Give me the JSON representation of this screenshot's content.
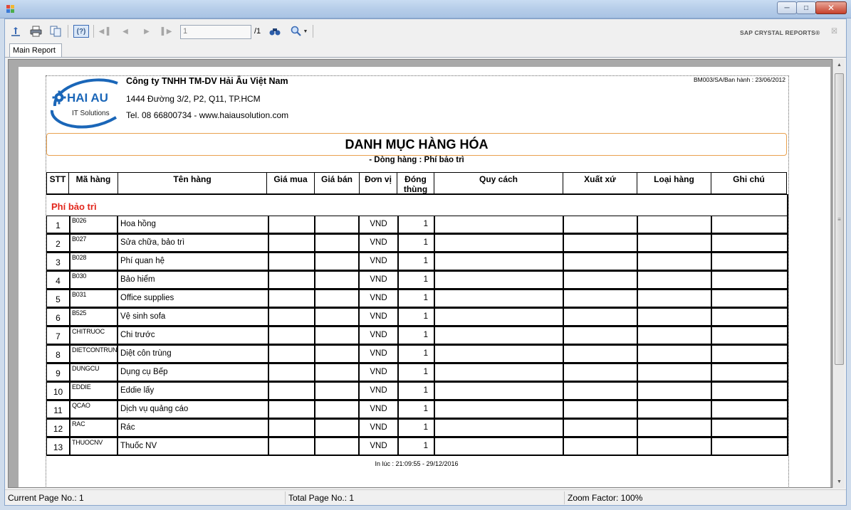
{
  "toolbar": {
    "page_value": "1",
    "page_total": "/1",
    "brand": "SAP CRYSTAL REPORTS®",
    "help_label": "(?)"
  },
  "tabs": [
    {
      "label": "Main Report"
    }
  ],
  "report": {
    "logo_text": "HAI AU",
    "logo_sub": "IT Solutions",
    "company_name": "Công ty TNHH TM-DV Hải Âu Việt Nam",
    "company_address": "1444 Đường 3/2, P2, Q11, TP.HCM",
    "company_contact": "Tel. 08 66800734 - www.haiausolution.com",
    "doc_code": "BM003/SA/Ban hành : 23/06/2012",
    "title": "DANH MỤC HÀNG HÓA",
    "subtitle": "- Dòng hàng : Phí bảo trì",
    "group_label": "Phí bảo trì",
    "print_time": "In lúc : 21:09:55 - 29/12/2016",
    "columns": {
      "stt": "STT",
      "code": "Mã hàng",
      "name": "Tên hàng",
      "buy": "Giá mua",
      "sell": "Giá bán",
      "unit": "Đơn vị",
      "pack1": "Đóng",
      "pack2": "thùng",
      "spec": "Quy cách",
      "origin": "Xuất xứ",
      "type": "Loại hàng",
      "note": "Ghi chú"
    },
    "rows": [
      {
        "stt": "1",
        "code": "B026",
        "name": "Hoa hồng",
        "unit": "VND",
        "qty": "1"
      },
      {
        "stt": "2",
        "code": "B027",
        "name": "Sửa chữa, bảo trì",
        "unit": "VND",
        "qty": "1"
      },
      {
        "stt": "3",
        "code": "B028",
        "name": "Phí quan hệ",
        "unit": "VND",
        "qty": "1"
      },
      {
        "stt": "4",
        "code": "B030",
        "name": "Bảo hiểm",
        "unit": "VND",
        "qty": "1"
      },
      {
        "stt": "5",
        "code": "B031",
        "name": "Office supplies",
        "unit": "VND",
        "qty": "1"
      },
      {
        "stt": "6",
        "code": "B525",
        "name": "Vệ sinh sofa",
        "unit": "VND",
        "qty": "1"
      },
      {
        "stt": "7",
        "code": "CHITRUOC",
        "name": "Chi trước",
        "unit": "VND",
        "qty": "1"
      },
      {
        "stt": "8",
        "code": "DIETCONTRUNG",
        "name": "Diệt côn trùng",
        "unit": "VND",
        "qty": "1"
      },
      {
        "stt": "9",
        "code": "DUNGCU",
        "name": "Dụng cụ Bếp",
        "unit": "VND",
        "qty": "1"
      },
      {
        "stt": "10",
        "code": "EDDIE",
        "name": "Eddie lấy",
        "unit": "VND",
        "qty": "1"
      },
      {
        "stt": "11",
        "code": "QCAO",
        "name": "Dịch vụ quảng cáo",
        "unit": "VND",
        "qty": "1"
      },
      {
        "stt": "12",
        "code": "RAC",
        "name": "Rác",
        "unit": "VND",
        "qty": "1"
      },
      {
        "stt": "13",
        "code": "THUOCNV",
        "name": "Thuốc NV",
        "unit": "VND",
        "qty": "1"
      }
    ]
  },
  "status": {
    "current_page": "Current Page No.: 1",
    "total_page": "Total Page No.: 1",
    "zoom": "Zoom Factor: 100%"
  },
  "icons": [
    "export-icon",
    "print-icon",
    "copy-icon",
    "help-icon",
    "first-page-icon",
    "prev-page-icon",
    "next-page-icon",
    "last-page-icon",
    "find-icon",
    "zoom-icon"
  ],
  "colors": {
    "group_label": "#e2261c",
    "title_border": "#e9a14f",
    "logo_blue": "#1a66b8"
  }
}
